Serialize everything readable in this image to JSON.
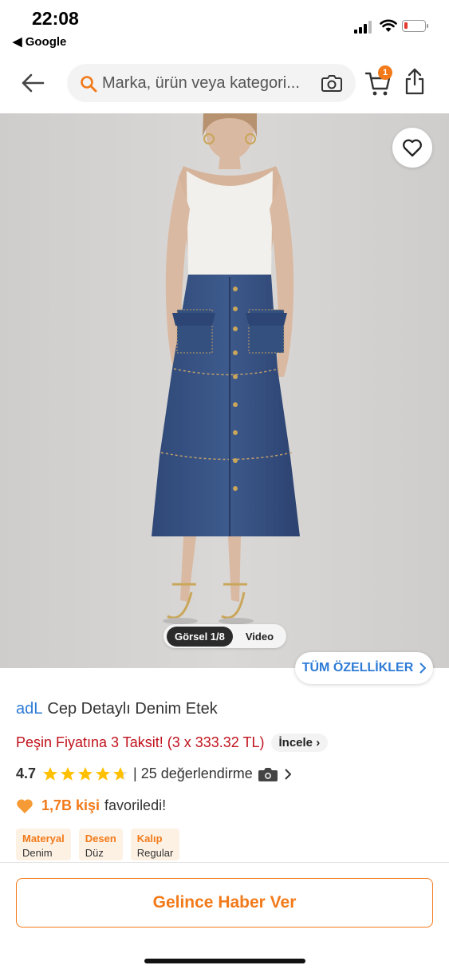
{
  "status": {
    "time": "22:08",
    "back_app": "Google"
  },
  "header": {
    "search_placeholder": "Marka, ürün veya kategori...",
    "cart_count": "1"
  },
  "gallery": {
    "counter": "Görsel 1/8",
    "video_label": "Video"
  },
  "features_button": "TÜM ÖZELLİKLER",
  "product": {
    "brand": "adL",
    "name": "Cep Detaylı Denim Etek",
    "installment": "Peşin Fiyatına 3 Taksit! (3 x 333.32 TL)",
    "installment_link": "İncele",
    "rating": "4.7",
    "rating_stars": 4.7,
    "reviews": "| 25 değerlendirme",
    "fav_count": "1,7B kişi",
    "fav_text": "favoriledi!",
    "attributes": [
      {
        "label": "Materyal",
        "value": "Denim"
      },
      {
        "label": "Desen",
        "value": "Düz"
      },
      {
        "label": "Kalıp",
        "value": "Regular"
      }
    ]
  },
  "bottom": {
    "notify_button": "Gelince Haber Ver"
  },
  "colors": {
    "accent": "#f27a1a",
    "link": "#2d7bd6",
    "price_red": "#c1121c"
  }
}
